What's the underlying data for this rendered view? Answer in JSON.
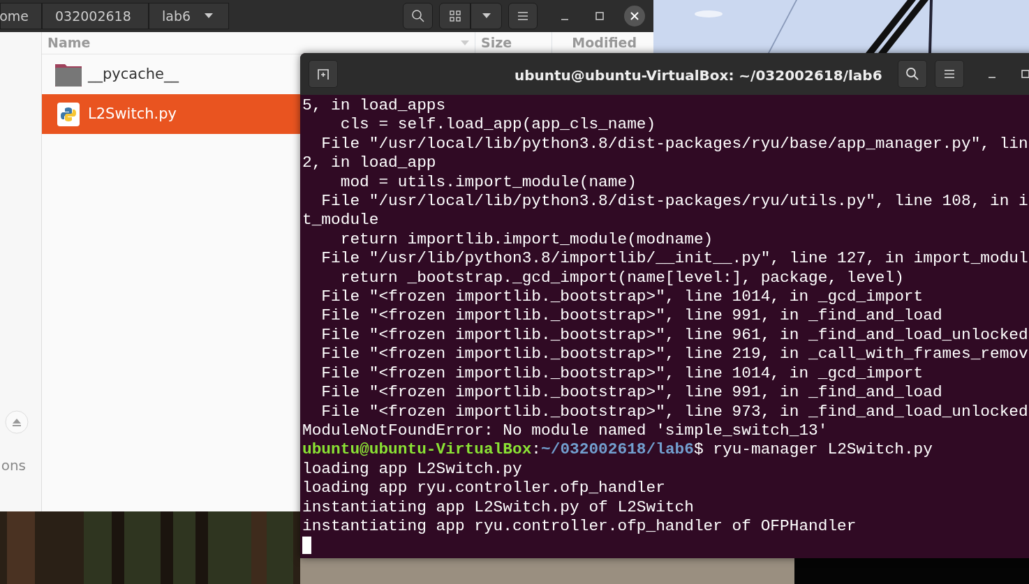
{
  "file_manager": {
    "path": [
      {
        "label": "ome"
      },
      {
        "label": "032002618"
      },
      {
        "label": "lab6",
        "dropdown": true
      }
    ],
    "columns": [
      {
        "label": "Name",
        "sorted": true
      },
      {
        "label": "Size",
        "sorted": false
      },
      {
        "label": "Modified",
        "sorted": false
      }
    ],
    "files": [
      {
        "name": "__pycache__",
        "kind": "folder",
        "selected": false
      },
      {
        "name": "L2Switch.py",
        "kind": "python",
        "selected": true
      }
    ],
    "sidebar": {
      "label": "ons"
    }
  },
  "terminal": {
    "title": "ubuntu@ubuntu-VirtualBox: ~/032002618/lab6",
    "lines": [
      {
        "kind": "output",
        "text": "5, in load_apps"
      },
      {
        "kind": "output",
        "text": "    cls = self.load_app(app_cls_name)"
      },
      {
        "kind": "output",
        "text": "  File \"/usr/local/lib/python3.8/dist-packages/ryu/base/app_manager.py\", lin"
      },
      {
        "kind": "output",
        "text": "2, in load_app"
      },
      {
        "kind": "output",
        "text": "    mod = utils.import_module(name)"
      },
      {
        "kind": "output",
        "text": "  File \"/usr/local/lib/python3.8/dist-packages/ryu/utils.py\", line 108, in i"
      },
      {
        "kind": "output",
        "text": "t_module"
      },
      {
        "kind": "output",
        "text": "    return importlib.import_module(modname)"
      },
      {
        "kind": "output",
        "text": "  File \"/usr/lib/python3.8/importlib/__init__.py\", line 127, in import_modul"
      },
      {
        "kind": "output",
        "text": "    return _bootstrap._gcd_import(name[level:], package, level)"
      },
      {
        "kind": "output",
        "text": "  File \"<frozen importlib._bootstrap>\", line 1014, in _gcd_import"
      },
      {
        "kind": "output",
        "text": "  File \"<frozen importlib._bootstrap>\", line 991, in _find_and_load"
      },
      {
        "kind": "output",
        "text": "  File \"<frozen importlib._bootstrap>\", line 961, in _find_and_load_unlocked"
      },
      {
        "kind": "output",
        "text": "  File \"<frozen importlib._bootstrap>\", line 219, in _call_with_frames_remov"
      },
      {
        "kind": "output",
        "text": "  File \"<frozen importlib._bootstrap>\", line 1014, in _gcd_import"
      },
      {
        "kind": "output",
        "text": "  File \"<frozen importlib._bootstrap>\", line 991, in _find_and_load"
      },
      {
        "kind": "output",
        "text": "  File \"<frozen importlib._bootstrap>\", line 973, in _find_and_load_unlocked"
      },
      {
        "kind": "output",
        "text": "ModuleNotFoundError: No module named 'simple_switch_13'"
      },
      {
        "kind": "prompt",
        "user": "ubuntu@ubuntu-VirtualBox",
        "sep": ":",
        "path": "~/032002618/lab6",
        "command": "$ ryu-manager L2Switch.py"
      },
      {
        "kind": "output",
        "text": "loading app L2Switch.py"
      },
      {
        "kind": "output",
        "text": "loading app ryu.controller.ofp_handler"
      },
      {
        "kind": "output",
        "text": "instantiating app L2Switch.py of L2Switch"
      },
      {
        "kind": "output",
        "text": "instantiating app ryu.controller.ofp_handler of OFPHandler"
      }
    ]
  }
}
